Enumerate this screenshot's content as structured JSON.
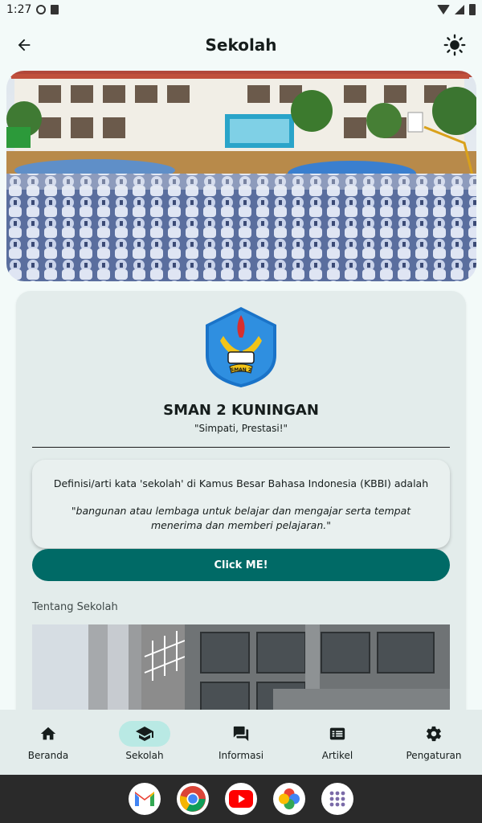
{
  "status": {
    "time": "1:27"
  },
  "app_bar": {
    "title": "Sekolah"
  },
  "school": {
    "name": "SMAN 2 KUNINGAN",
    "motto": "\"Simpati, Prestasi!\"",
    "logo_text": "SMAN 2"
  },
  "definition": {
    "intro": "Definisi/arti kata 'sekolah' di Kamus Besar Bahasa Indonesia (KBBI) adalah",
    "quote": "\"bangunan atau lembaga untuk belajar dan mengajar serta tempat menerima dan memberi pelajaran.\""
  },
  "cta_label": "Click ME!",
  "about_label": "Tentang Sekolah",
  "bottom_nav": [
    {
      "label": "Beranda",
      "icon": "home-icon"
    },
    {
      "label": "Sekolah",
      "icon": "school-icon",
      "active": true
    },
    {
      "label": "Informasi",
      "icon": "forum-icon"
    },
    {
      "label": "Artikel",
      "icon": "article-icon"
    },
    {
      "label": "Pengaturan",
      "icon": "settings-icon"
    }
  ],
  "dock_apps": [
    "gmail-icon",
    "chrome-icon",
    "youtube-icon",
    "photos-icon",
    "app-drawer-icon"
  ],
  "colors": {
    "primary": "#006a66",
    "active_pill": "#b9e9e4",
    "background": "#f3faf9",
    "card": "#e3eceb"
  }
}
